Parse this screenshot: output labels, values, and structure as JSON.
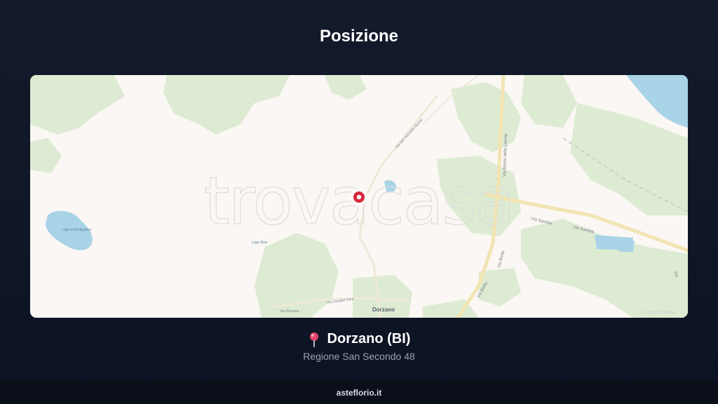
{
  "header": {
    "title": "Posizione"
  },
  "map": {
    "watermark": "trovacasa",
    "attribution": "© OpenStreetMap",
    "marker": {
      "icon": "map-marker-icon",
      "color": "#d7263d"
    },
    "labels": {
      "lake_name": "Lago di Bertignano",
      "pond_name": "Lago Bosi",
      "town": "Dorzano",
      "via_san_secondo": "Via San Secondo Martire",
      "via_martiri": "Via Martiri della Libertà",
      "via_santhia_1": "Via Santhià",
      "via_santhia_2": "Via Santhià",
      "via_biella_1": "Via Biella",
      "via_biella_2": "Via Biella",
      "via_dorzano": "Via Dorzano",
      "via_cavalier": "Via Cavalier Cora",
      "via_right": "Via"
    },
    "colors": {
      "land": "#fbf7f4",
      "green": "#dcebd2",
      "water": "#a9d3e6",
      "road": "#f4e6b8"
    }
  },
  "location": {
    "pin_icon": "pushpin-icon",
    "name": "Dorzano (BI)",
    "address": "Regione San Secondo 48"
  },
  "footer": {
    "site": "asteflorio.it"
  }
}
